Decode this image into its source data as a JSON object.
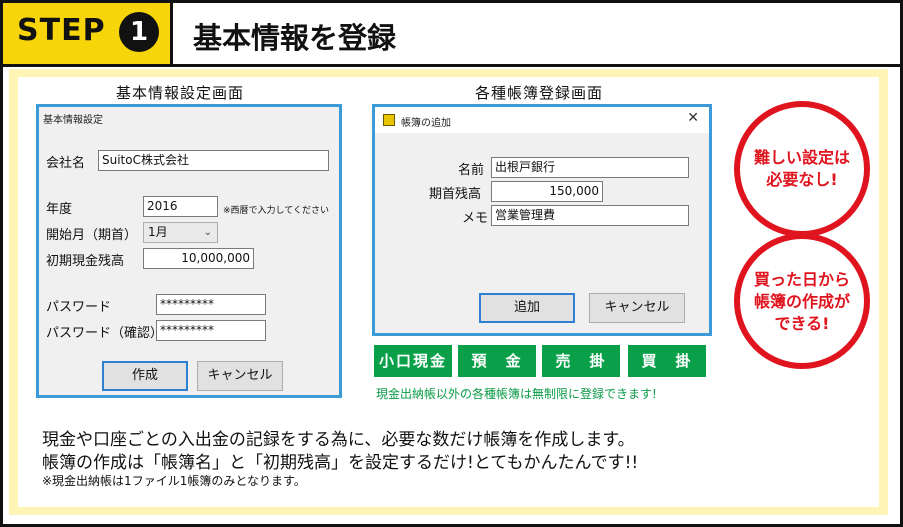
{
  "header": {
    "step_label": "STEP",
    "step_number": "1",
    "title": "基本情報を登録"
  },
  "left_section": {
    "caption": "基本情報設定画面",
    "window_title": "基本情報設定",
    "company_label": "会社名",
    "company_value": "SuitoC株式会社",
    "year_label": "年度",
    "year_value": "2016",
    "year_note": "※西暦で入力してください",
    "start_month_label": "開始月（期首）",
    "start_month_value": "1月",
    "opening_cash_label": "初期現金残高",
    "opening_cash_value": "10,000,000",
    "password_label": "パスワード",
    "password_value": "*********",
    "password_confirm_label": "パスワード（確認）",
    "password_confirm_value": "*********",
    "create_button": "作成",
    "cancel_button": "キャンセル"
  },
  "right_section": {
    "caption": "各種帳簿登録画面",
    "window_title": "帳簿の追加",
    "name_label": "名前",
    "name_value": "出根戸銀行",
    "opening_balance_label": "期首残高",
    "opening_balance_value": "150,000",
    "memo_label": "メモ",
    "memo_value": "営業管理費",
    "add_button": "追加",
    "cancel_button": "キャンセル",
    "close_glyph": "✕"
  },
  "ledger_tabs": [
    "小口現金",
    "預　金",
    "売　掛",
    "買　掛"
  ],
  "green_note": "現金出納帳以外の各種帳簿は無制限に登録できます!",
  "callouts": {
    "first": [
      "難しい設定は",
      "必要なし!"
    ],
    "second": [
      "買った日から",
      "帳簿の作成が",
      "できる!"
    ]
  },
  "body_text": {
    "line1": "現金や口座ごとの入出金の記録をする為に、必要な数だけ帳簿を作成します。",
    "line2": "帳簿の作成は「帳簿名」と「初期残高」を設定するだけ!とてもかんたんです!!",
    "note": "※現金出納帳は1ファイル1帳簿のみとなります。"
  },
  "colors": {
    "step_yellow": "#f7d50a",
    "panel_yellow": "#fdf4b6",
    "window_border_blue": "#3a9bd8",
    "tab_green": "#0aa04a",
    "callout_red": "#e0141e"
  }
}
